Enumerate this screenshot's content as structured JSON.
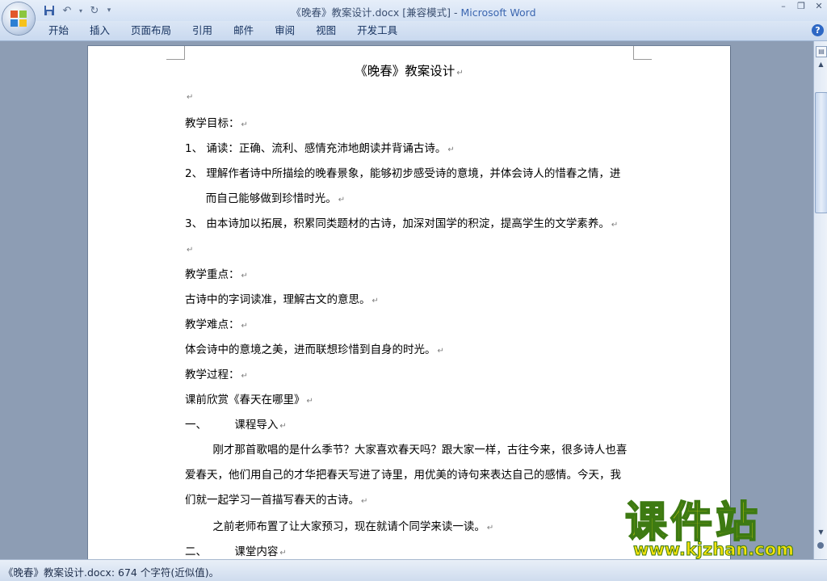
{
  "window": {
    "title": "《晚春》教案设计.docx [兼容模式]",
    "title_separator": " - ",
    "app_name": "Microsoft Word",
    "controls": [
      "minimize-icon",
      "restore-icon",
      "close-icon"
    ]
  },
  "quick_access": [
    "save-icon",
    "undo-icon",
    "redo-icon",
    "customize-icon"
  ],
  "ribbon": {
    "tabs": [
      "开始",
      "插入",
      "页面布局",
      "引用",
      "邮件",
      "审阅",
      "视图",
      "开发工具"
    ],
    "help_label": "?"
  },
  "document": {
    "paragraph_mark": "↵",
    "heading": "《晚春》教案设计",
    "paragraphs": [
      "",
      "教学目标：",
      "1、 诵读：正确、流利、感情充沛地朗读并背诵古诗。",
      "2、 理解作者诗中所描绘的晚春景象，能够初步感受诗的意境，并体会诗人的惜春之情，进",
      "      而自己能够做到珍惜时光。",
      "3、 由本诗加以拓展，积累同类题材的古诗，加深对国学的积淀，提高学生的文学素养。",
      "",
      "教学重点：",
      "古诗中的字词读准，理解古文的意思。",
      "教学难点：",
      "体会诗中的意境之美，进而联想珍惜到自身的时光。",
      "教学过程：",
      "课前欣赏《春天在哪里》",
      "一、        课程导入",
      "        刚才那首歌唱的是什么季节？大家喜欢春天吗？跟大家一样，古往今来，很多诗人也喜",
      "爱春天，他们用自己的才华把春天写进了诗里，用优美的诗句来表达自己的感情。今天，我",
      "们就一起学习一首描写春天的古诗。",
      "        之前老师布置了让大家预习，现在就请个同学来读一读。",
      "二、        课堂内容"
    ]
  },
  "watermark": {
    "text": "课件站",
    "url": "www.kjzhan.com"
  },
  "status_bar": {
    "text": "《晚春》教案设计.docx: 674 个字符(近似值)。"
  }
}
